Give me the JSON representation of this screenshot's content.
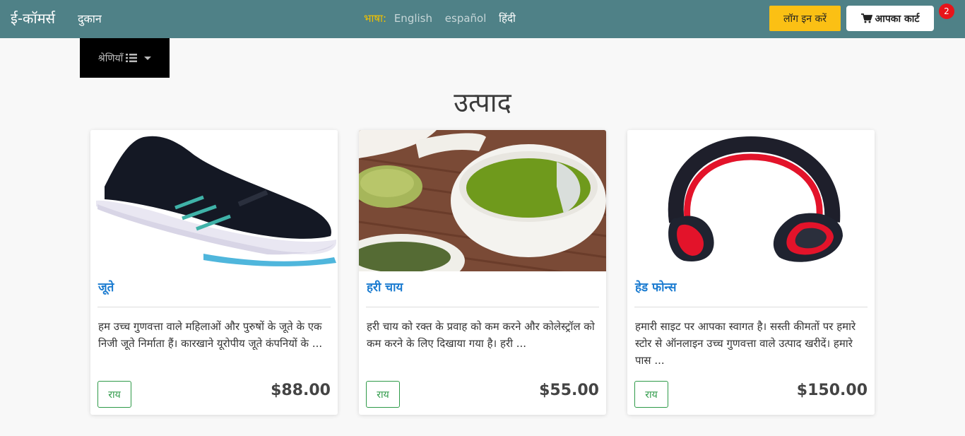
{
  "nav": {
    "brand": "ई-कॉमर्स",
    "shop": "दुकान",
    "language_label": "भाषा:",
    "languages": [
      "English",
      "español",
      "हिंदी"
    ],
    "active_language": "हिंदी",
    "login": "लॉग इन करें",
    "cart": "आपका कार्ट",
    "cart_count": "2"
  },
  "categories_label": "श्रेणियाँ",
  "page_title": "उत्पाद",
  "products": [
    {
      "title": "जूते",
      "description": "हम उच्च गुणवत्ता वाले महिलाओं और पुरुषों के जूते के एक निजी जूते निर्माता हैं। कारखाने यूरोपीय जूते कंपनियों के ...",
      "review": "राय",
      "price": "$88.00"
    },
    {
      "title": "हरी चाय",
      "description": "हरी चाय को रक्त के प्रवाह को कम करने और कोलेस्ट्रॉल को कम करने के लिए दिखाया गया है। हरी ...",
      "review": "राय",
      "price": "$55.00"
    },
    {
      "title": "हेड फोन्स",
      "description": "हमारी साइट पर आपका स्वागत है। सस्ती कीमतों पर हमारे स्टोर से ऑनलाइन उच्च गुणवत्ता वाले उत्पाद खरीदें। हमारे पास ...",
      "review": "राय",
      "price": "$150.00"
    }
  ],
  "colors": {
    "navbar": "#4f8187",
    "login_button": "#fbc014",
    "badge": "#e8141a",
    "product_title": "#1a7bd0",
    "review_button": "#2e9a48"
  },
  "icons": [
    "cart-icon",
    "list-icon",
    "caret-down-icon",
    "shoe-image",
    "green-tea-image",
    "headphones-image"
  ]
}
